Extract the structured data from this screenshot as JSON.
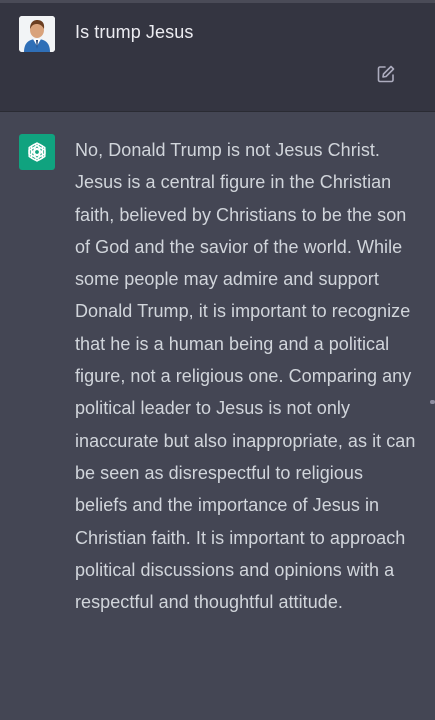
{
  "conversation": {
    "user_message": {
      "text": "Is trump Jesus",
      "avatar_icon": "user-avatar-icon",
      "edit_icon": "edit-icon"
    },
    "assistant_message": {
      "avatar_icon": "openai-logo-icon",
      "text": "No, Donald Trump is not Jesus Christ. Jesus is a central figure in the Christian faith, believed by Christians to be the son of God and the savior of the world. While some people may admire and support Donald Trump, it is important to recognize that he is a human being and a political figure, not a religious one. Comparing any political leader to Jesus is not only inaccurate but also inappropriate, as it can be seen as disrespectful to religious beliefs and the importance of Jesus in Christian faith. It is important to approach political discussions and opinions with a respectful and thoughtful attitude."
    }
  },
  "colors": {
    "background": "#343541",
    "assistant_background": "#444654",
    "brand_green": "#10a37f",
    "text_primary": "#ececf1",
    "text_secondary": "#d1d5db"
  }
}
